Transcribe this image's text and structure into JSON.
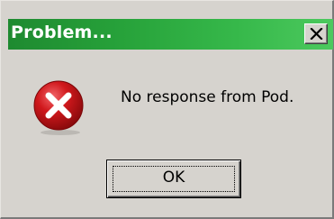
{
  "window": {
    "title": "Problem...",
    "title_bar_color": "#27a23a"
  },
  "close_button": {
    "icon": "close-icon"
  },
  "message": {
    "icon": "error-icon",
    "icon_color": "#d0181c",
    "text": "No response from Pod."
  },
  "buttons": {
    "ok_label": "OK"
  }
}
